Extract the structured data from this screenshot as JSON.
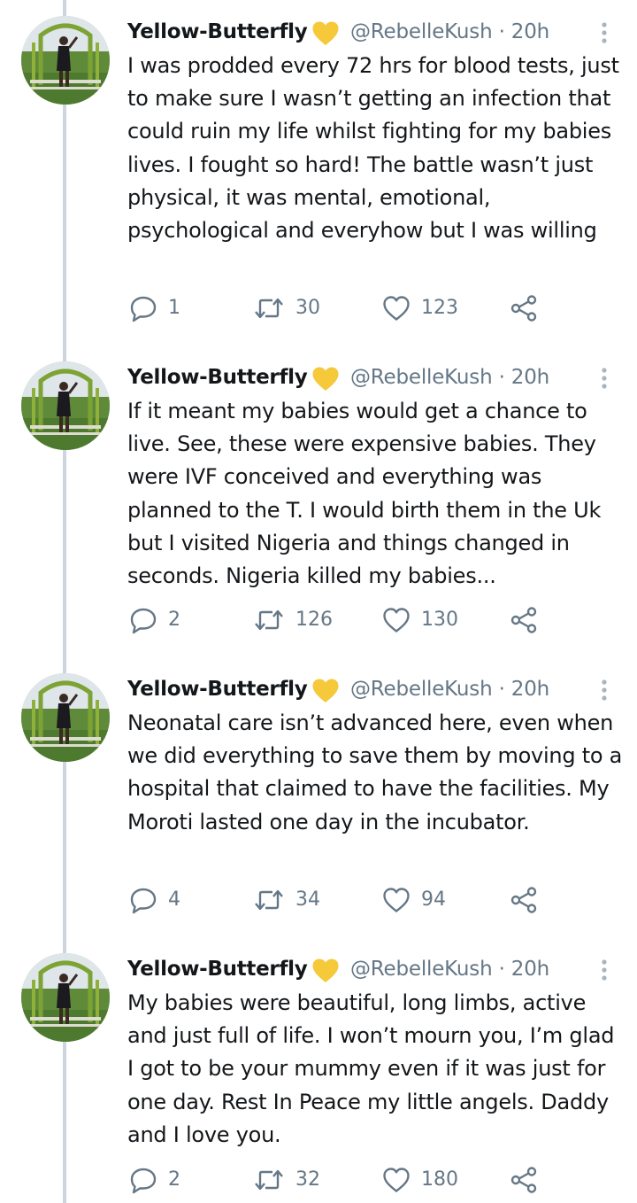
{
  "colors": {
    "text": "#14171a",
    "muted": "#657786",
    "thread_line": "#cdd5de",
    "heart_emoji": "#f5c93a"
  },
  "tweets": [
    {
      "name": "Yellow-Butterfly",
      "emoji": "yellow-heart-icon",
      "handle_time": "@RebelleKush · 20h",
      "text": "I was prodded every 72 hrs for blood tests, just to make sure I wasn’t getting an infection that could ruin my life whilst fighting for my babies lives. I fought so hard! The battle wasn’t just physical, it was mental, emotional, psychological and everyhow but I was willing",
      "replies": "1",
      "retweets": "30",
      "likes": "123"
    },
    {
      "name": "Yellow-Butterfly",
      "emoji": "yellow-heart-icon",
      "handle_time": "@RebelleKush · 20h",
      "text": "If it meant my babies would get a chance to live. See, these were expensive babies. They were IVF conceived and everything was planned to the T. I would birth them in the Uk but I visited Nigeria and things changed in seconds. Nigeria killed my babies...",
      "replies": "2",
      "retweets": "126",
      "likes": "130"
    },
    {
      "name": "Yellow-Butterfly",
      "emoji": "yellow-heart-icon",
      "handle_time": "@RebelleKush · 20h",
      "text": "Neonatal care isn’t advanced here, even when we did everything to save them by moving to a hospital that claimed to have the facilities. My Moroti lasted one day in the incubator.",
      "replies": "4",
      "retweets": "34",
      "likes": "94"
    },
    {
      "name": "Yellow-Butterfly",
      "emoji": "yellow-heart-icon",
      "handle_time": "@RebelleKush · 20h",
      "text": "My babies were beautiful, long limbs, active and just full of life. I won’t mourn you, I’m glad I got to be your mummy even if it was just for one day. Rest In Peace my little angels. Daddy and I love you.",
      "replies": "2",
      "retweets": "32",
      "likes": "180"
    }
  ]
}
